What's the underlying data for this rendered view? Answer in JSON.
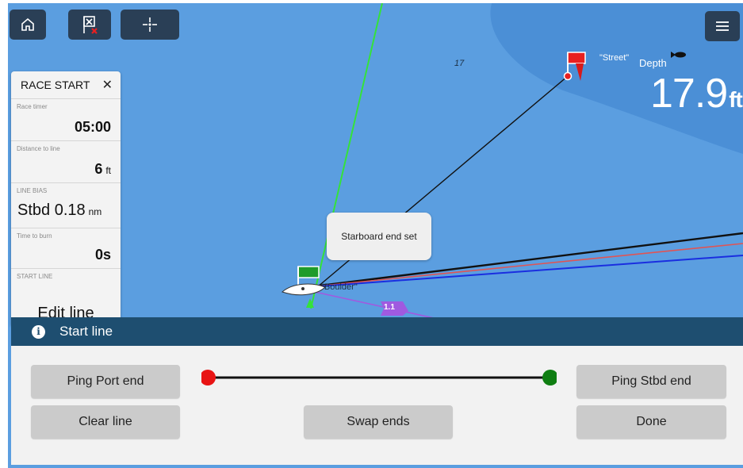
{
  "toolbar": {
    "buttons": [
      {
        "icon": "home-icon"
      },
      {
        "icon": "clear-mark-icon"
      },
      {
        "icon": "crosshair-icon"
      }
    ],
    "menu_icon": "menu-icon"
  },
  "map": {
    "depth_label": "Depth",
    "depth_value": "17.9",
    "depth_unit": "ft",
    "chart_number": "17",
    "mark_label": "\"Street\"",
    "boat_label": "\"Boulder\"",
    "route_label": "1.1",
    "colors": {
      "water": "#5b9ee0",
      "shallow": "#4b8fd6",
      "laylines_green": "#35e23a",
      "start_line_black": "#111111",
      "red_line": "#e05454",
      "blue_line": "#1a2ee0",
      "route_purple": "#a05ae0"
    }
  },
  "race_start": {
    "title": "RACE START",
    "close": "✕",
    "race_timer_label": "Race timer",
    "race_timer_value": "05:00",
    "distance_label": "Distance to line",
    "distance_value": "6",
    "distance_unit": "ft",
    "line_bias_label": "LINE BIAS",
    "line_bias_value": "Stbd 0.18",
    "line_bias_unit": "nm",
    "time_to_burn_label": "Time to burn",
    "time_to_burn_value": "0s",
    "start_line_label": "START LINE",
    "edit_line": "Edit line"
  },
  "toast": {
    "text": "Starboard end set"
  },
  "dialog": {
    "title": "Start line",
    "ping_port": "Ping Port end",
    "ping_stbd": "Ping Stbd end",
    "clear_line": "Clear line",
    "swap_ends": "Swap ends",
    "done": "Done",
    "port_color": "#e81414",
    "stbd_color": "#0f7e12"
  }
}
